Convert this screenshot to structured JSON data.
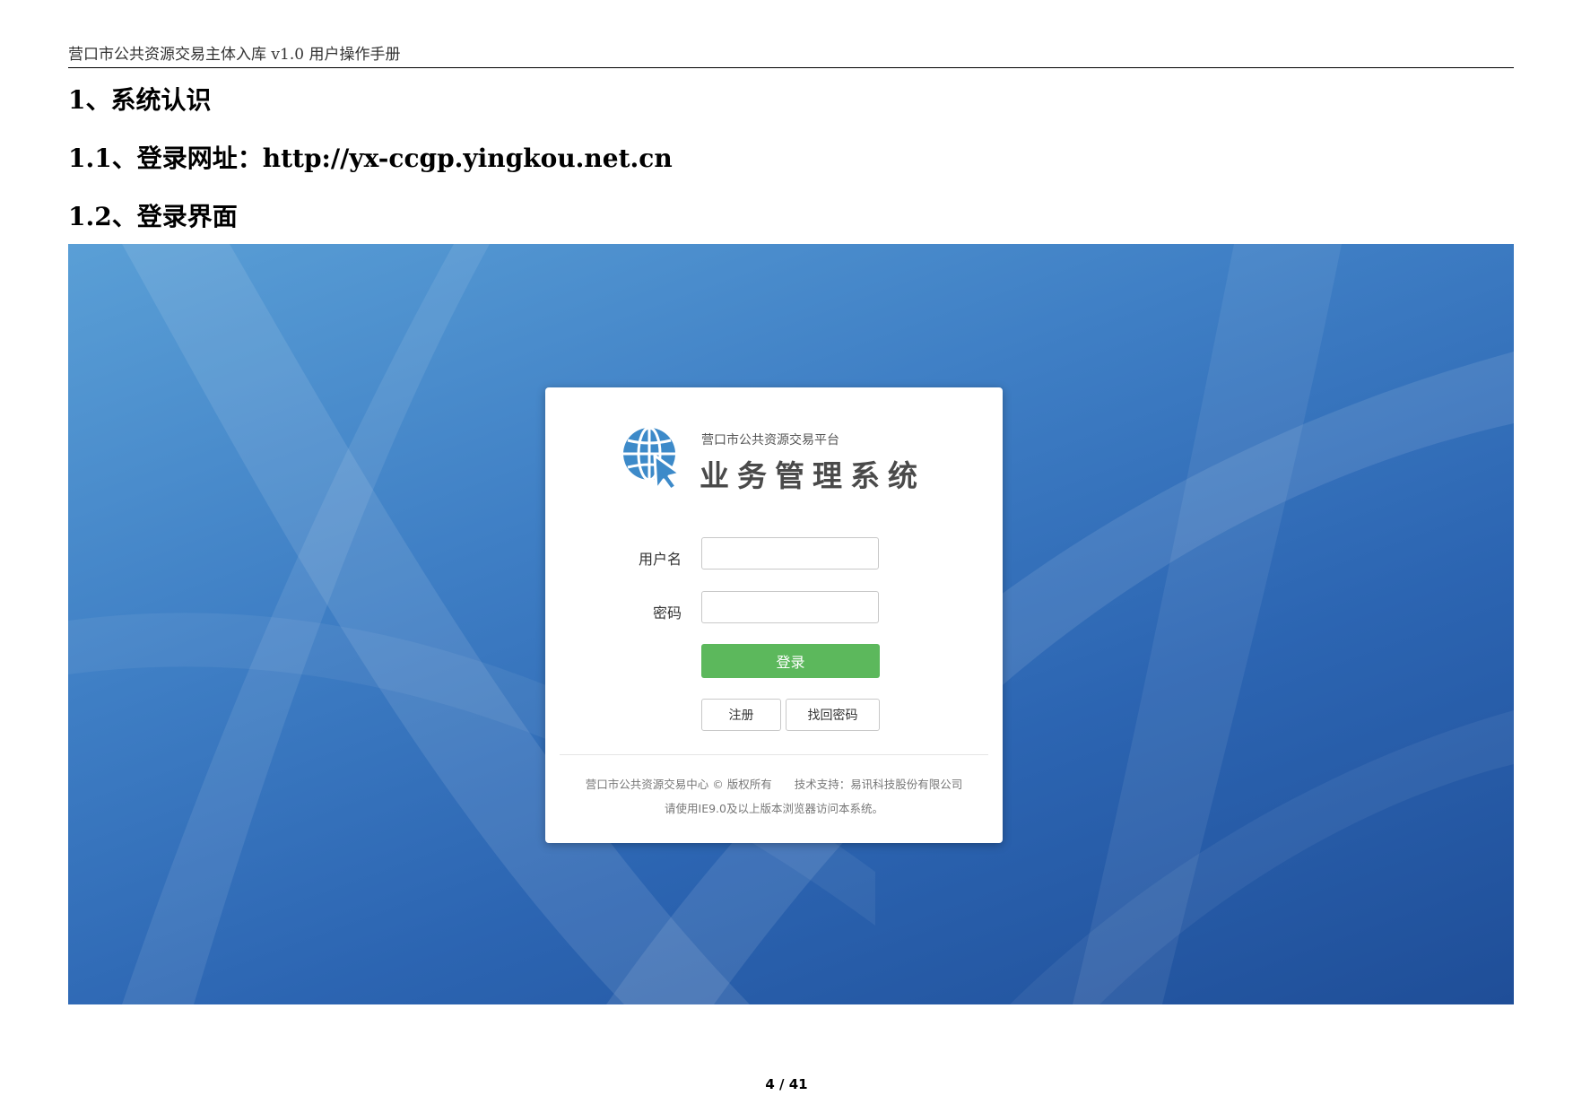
{
  "header": {
    "text": "营口市公共资源交易主体入库 v1.0 用户操作手册"
  },
  "sections": [
    {
      "heading": "1、系统认识"
    },
    {
      "heading": "1.1、登录网址：http://yx-ccgp.yingkou.net.cn"
    },
    {
      "heading": "1.2、登录界面"
    }
  ],
  "login": {
    "platform_name": "营口市公共资源交易平台",
    "system_name": "业务管理系统",
    "username_label": "用户名",
    "username_value": "",
    "password_label": "密码",
    "password_value": "",
    "login_button": "登录",
    "register_button": "注册",
    "recover_button": "找回密码",
    "footer_line1": "营口市公共资源交易中心 © 版权所有　　技术支持：易讯科技股份有限公司",
    "footer_line2": "请使用IE9.0及以上版本浏览器访问本系统。",
    "logo_icon": "globe-cursor-icon",
    "accent_color": "#5cb85c",
    "logo_color": "#3d8ac9"
  },
  "footer": {
    "page": "4 / 41"
  }
}
